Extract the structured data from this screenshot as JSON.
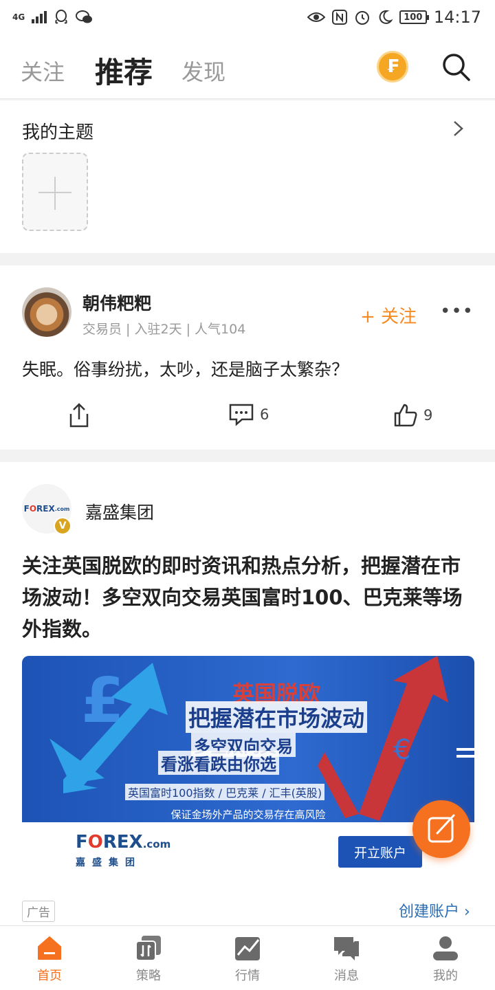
{
  "status_bar": {
    "network": "4G",
    "battery": "100",
    "time": "14:17"
  },
  "header": {
    "tabs": [
      {
        "label": "关注"
      },
      {
        "label": "推荐"
      },
      {
        "label": "发现"
      }
    ],
    "coin_glyph": "₣",
    "accent_color": "#f6711f"
  },
  "topics": {
    "title": "我的主题"
  },
  "post1": {
    "author": "朝伟粑粑",
    "meta": "交易员 | 入驻2天 | 人气104",
    "follow_label": "+ 关注",
    "text": "失眠。俗事纷扰，太吵，还是脑子太繁杂？",
    "comments": "6",
    "likes": "9"
  },
  "post2": {
    "brand_logo_main": "F",
    "brand_logo_o": "O",
    "brand_logo_rest": "REX",
    "brand_logo_suffix": ".com",
    "verified_badge": "V",
    "author": "嘉盛集团",
    "text": "关注英国脱欧的即时资讯和热点分析，把握潜在市场波动！多空双向交易英国富时100、巴克莱等场外指数。",
    "banner": {
      "title1": "英国脱欧",
      "title2": "把握潜在市场波动",
      "sub1": "多空双向交易",
      "sub2": "看涨看跌由你选",
      "small": "英国富时100指数 / 巴克莱 / 汇丰(英股)",
      "risk": "保证金场外产品的交易存在高风险",
      "logo_sub": "嘉盛集团",
      "button": "开立账户"
    },
    "ad_label": "广告",
    "create_account": "创建账户 ›"
  },
  "tabbar": {
    "items": [
      {
        "label": "首页"
      },
      {
        "label": "策略"
      },
      {
        "label": "行情"
      },
      {
        "label": "消息"
      },
      {
        "label": "我的"
      }
    ]
  }
}
